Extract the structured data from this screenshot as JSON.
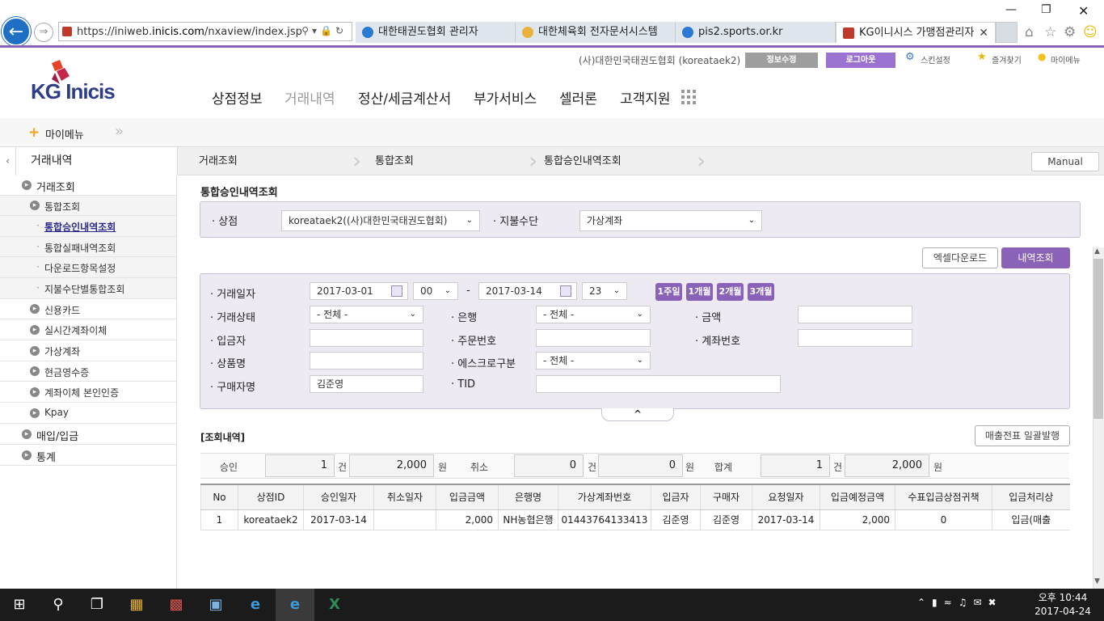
{
  "browser": {
    "url_prefix": "https://iniweb.",
    "url_domain": "inicis.com",
    "url_path": "/nxaview/index.jsp",
    "tabs": [
      {
        "label": "대한태권도협회 관리자"
      },
      {
        "label": "대한체육회 전자문서시스템"
      },
      {
        "label": "pis2.sports.or.kr"
      },
      {
        "label": "KG이니시스 가맹점관리자"
      }
    ]
  },
  "topbar": {
    "org": "(사)대한민국태권도협회 (koreataek2)",
    "edit_info": "정보수정",
    "logout": "로그아웃",
    "skin": "스킨설정",
    "favorites": "즐겨찾기",
    "mymenu": "마이메뉴"
  },
  "logo": {
    "kg": "KG",
    "inicis": "Inicis"
  },
  "nav": [
    "상점정보",
    "거래내역",
    "정산/세금계산서",
    "부가서비스",
    "셀러론",
    "고객지원"
  ],
  "mymenu_label": "마이메뉴",
  "breadcrumb": {
    "side": "거래내역",
    "items": [
      "거래조회",
      "통합조회",
      "통합승인내역조회"
    ],
    "manual": "Manual"
  },
  "sidebar": {
    "items": [
      {
        "label": "거래조회"
      },
      {
        "label": "통합조회"
      },
      {
        "label": "통합승인내역조회"
      },
      {
        "label": "통합실패내역조회"
      },
      {
        "label": "다운로드항목설정"
      },
      {
        "label": "지불수단별통합조회"
      },
      {
        "label": "신용카드"
      },
      {
        "label": "실시간계좌이체"
      },
      {
        "label": "가상계좌"
      },
      {
        "label": "현금영수증"
      },
      {
        "label": "계좌이체 본인인증"
      },
      {
        "label": "Kpay"
      },
      {
        "label": "매입/입금"
      },
      {
        "label": "통계"
      }
    ]
  },
  "page_title": "통합승인내역조회",
  "filter_top": {
    "store_label": "상점",
    "store_value": "koreataek2((사)대한민국태권도협회)",
    "pay_label": "지불수단",
    "pay_value": "가상계좌"
  },
  "actions": {
    "excel": "엑셀다운로드",
    "search": "내역조회"
  },
  "search": {
    "date_label": "거래일자",
    "date_from": "2017-03-01",
    "hour_from": "00",
    "sep": "-",
    "date_to": "2017-03-14",
    "hour_to": "23",
    "quick": [
      "1주일",
      "1개월",
      "2개월",
      "3개월"
    ],
    "status_label": "거래상태",
    "status_value": "- 전체 -",
    "bank_label": "은행",
    "bank_value": "- 전체 -",
    "amount_label": "금액",
    "depositor_label": "입금자",
    "order_label": "주문번호",
    "account_label": "계좌번호",
    "product_label": "상품명",
    "escrow_label": "에스크로구분",
    "escrow_value": "- 전체 -",
    "buyer_label": "구매자명",
    "buyer_value": "김준영",
    "tid_label": "TID",
    "collapse": "^"
  },
  "results": {
    "title": "[조회내역]",
    "bulk_btn": "매출전표 일괄발행",
    "summary": {
      "approve_label": "승인",
      "approve_count": "1",
      "approve_amount": "2,000",
      "cancel_label": "취소",
      "cancel_count": "0",
      "cancel_amount": "0",
      "total_label": "합계",
      "total_count": "1",
      "total_amount": "2,000",
      "unit_count": "건",
      "unit_won": "원"
    },
    "columns": [
      "No",
      "상점ID",
      "승인일자",
      "취소일자",
      "입금금액",
      "은행명",
      "가상계좌번호",
      "입금자",
      "구매자",
      "요청일자",
      "입금예정금액",
      "수표입금상점귀책",
      "입금처리상"
    ],
    "rows": [
      [
        "1",
        "koreataek2",
        "2017-03-14",
        "",
        "2,000",
        "NH농협은행",
        "01443764133413",
        "김준영",
        "김준영",
        "2017-03-14",
        "2,000",
        "0",
        "입금(매출"
      ]
    ]
  },
  "clock": {
    "time": "오후 10:44",
    "date": "2017-04-24"
  },
  "colors": {
    "accent": "#8a63b8",
    "logout": "#9b72cf",
    "edit_info": "#9e9e9e",
    "link_active": "#2a2a8a"
  }
}
